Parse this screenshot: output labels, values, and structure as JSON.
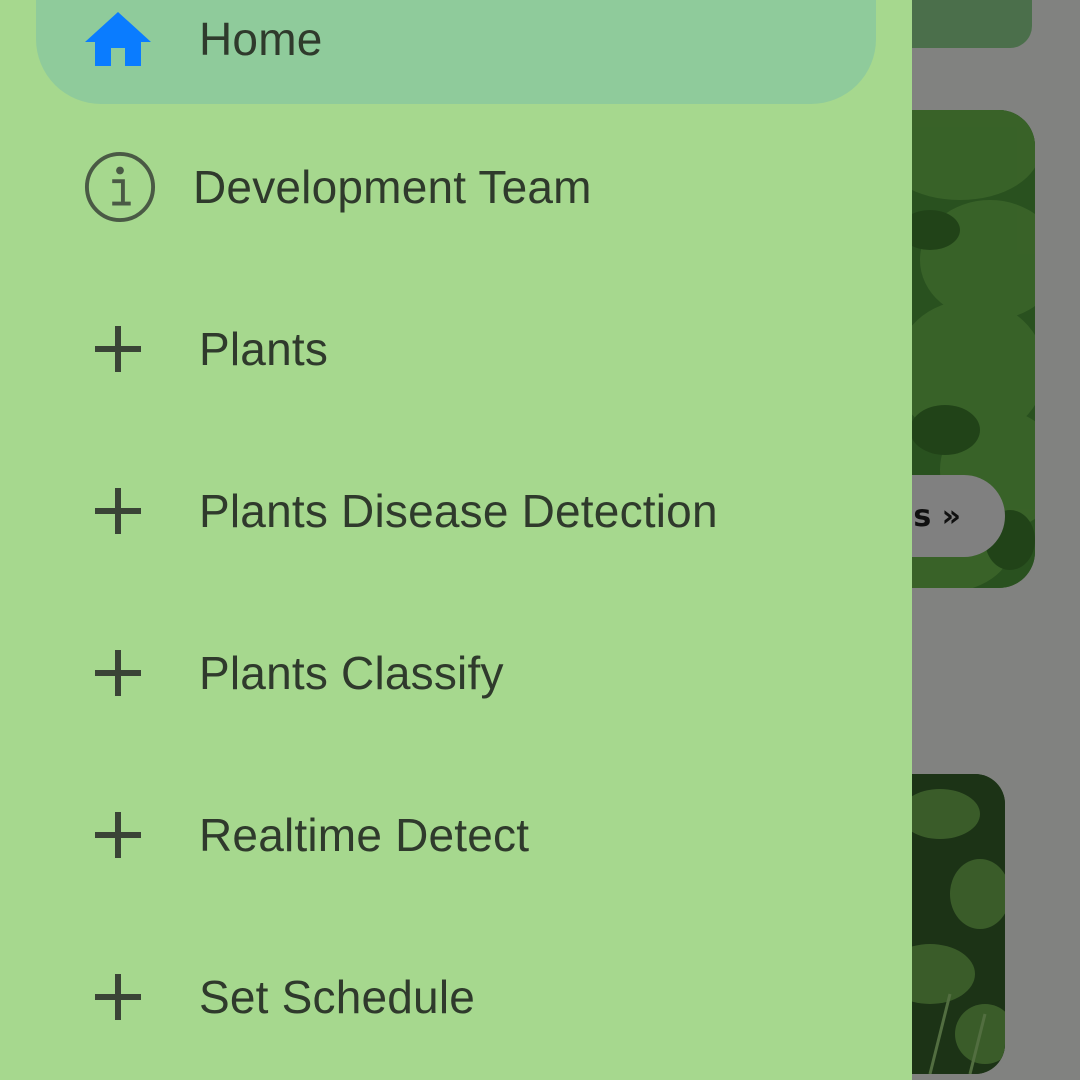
{
  "background": {
    "card_button_text": "s »"
  },
  "drawer": {
    "items": [
      {
        "label": "Home",
        "icon": "home-icon",
        "active": true
      },
      {
        "label": "Development Team",
        "icon": "info-icon"
      },
      {
        "label": "Plants",
        "icon": "plus-icon"
      },
      {
        "label": "Plants Disease Detection",
        "icon": "plus-icon"
      },
      {
        "label": "Plants Classify",
        "icon": "plus-icon"
      },
      {
        "label": "Realtime Detect",
        "icon": "plus-icon"
      },
      {
        "label": "Set Schedule",
        "icon": "plus-icon"
      }
    ]
  },
  "colors": {
    "drawer_bg": "#a6d88e",
    "active_item_bg": "#8fcb9b",
    "home_icon": "#0a7cff",
    "text": "#2f3a2c"
  }
}
